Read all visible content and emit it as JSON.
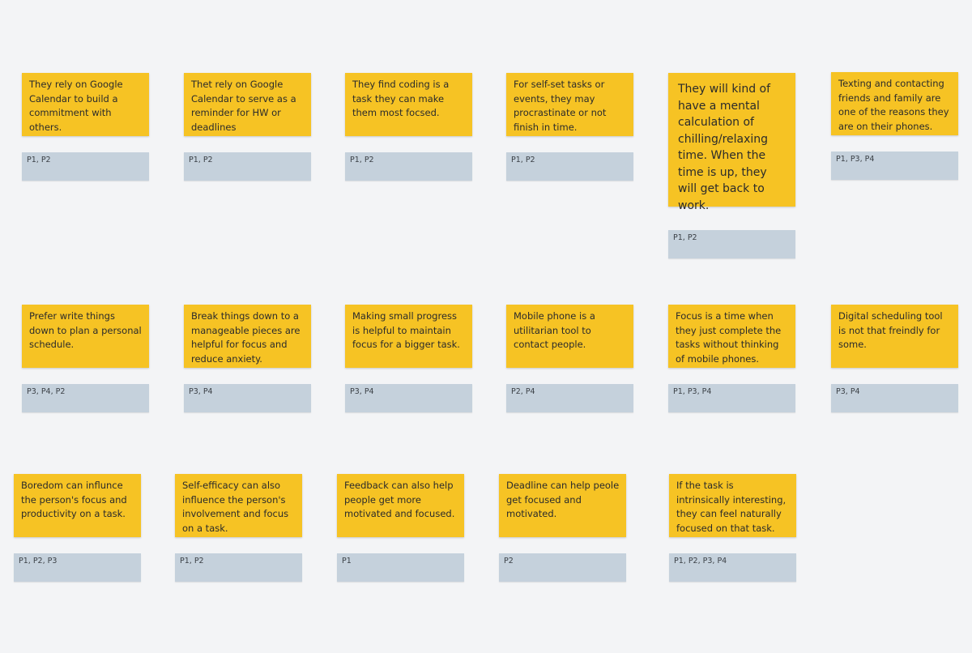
{
  "board": {
    "cards": [
      {
        "note": "They rely on Google Calendar to build a commitment with others.",
        "participants": "P1, P2"
      },
      {
        "note": "Thet rely on Google Calendar to serve as a reminder for HW or deadlines",
        "participants": "P1, P2"
      },
      {
        "note": "They find coding is a task they can make them most focsed.",
        "participants": "P1, P2"
      },
      {
        "note": "For self-set tasks or events, they may procrastinate or not finish in time.",
        "participants": "P1, P2"
      },
      {
        "note": "They will kind of have a mental calculation of chilling/relaxing time. When the time is up, they will get back to work.",
        "participants": "P1, P2"
      },
      {
        "note": "Texting and contacting friends and family are one of the reasons they are on their phones.",
        "participants": "P1, P3, P4"
      },
      {
        "note": "Prefer write things down to plan a personal schedule.",
        "participants": "P3, P4, P2"
      },
      {
        "note": "Break things down to a manageable pieces are helpful for focus and reduce anxiety.",
        "participants": "P3, P4"
      },
      {
        "note": "Making small progress is helpful to maintain focus for a bigger task.",
        "participants": "P3, P4"
      },
      {
        "note": "Mobile phone is a utilitarian tool to contact people.",
        "participants": "P2, P4"
      },
      {
        "note": "Focus is a time when they just complete the tasks without thinking of mobile phones.",
        "participants": "P1, P3, P4"
      },
      {
        "note": "Digital scheduling tool is not that freindly for some.",
        "participants": "P3, P4"
      },
      {
        "note": "Boredom can influnce the person's focus and productivity on a task.",
        "participants": "P1, P2, P3"
      },
      {
        "note": "Self-efficacy can also influence the person's involvement and focus on a task.",
        "participants": "P1, P2"
      },
      {
        "note": "Feedback can also help people get more motivated and focused.",
        "participants": "P1"
      },
      {
        "note": "Deadline can help peole get focused and motivated.",
        "participants": "P2"
      },
      {
        "note": "If the task is intrinsically interesting, they can feel naturally focused on that task.",
        "participants": "P1, P2, P3, P4"
      }
    ]
  },
  "colors": {
    "background": "#f3f4f6",
    "sticky_note": "#f6c324",
    "participant_tag": "#c5d1dc"
  }
}
